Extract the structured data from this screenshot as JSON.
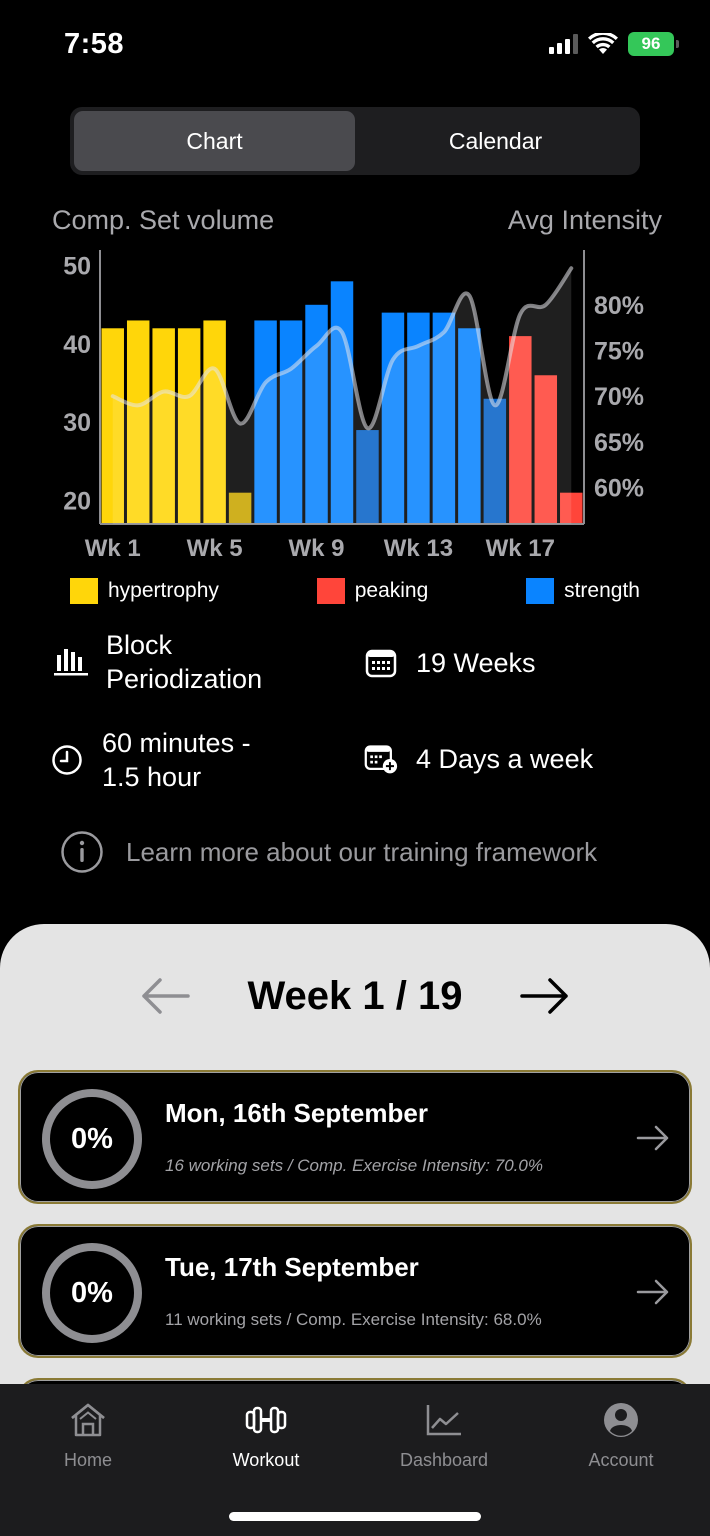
{
  "status": {
    "time": "7:58",
    "battery": "96"
  },
  "segments": [
    {
      "label": "Chart",
      "active": true
    },
    {
      "label": "Calendar",
      "active": false
    }
  ],
  "chart_data": {
    "type": "bar",
    "left_axis_label": "Comp. Set volume",
    "right_axis_label": "Avg Intensity",
    "left_ticks": [
      "50",
      "40",
      "30",
      "20"
    ],
    "right_ticks": [
      "80%",
      "75%",
      "70%",
      "65%",
      "60%"
    ],
    "ylim": [
      17,
      52
    ],
    "y2lim": [
      56,
      86
    ],
    "x_tick_labels": [
      "Wk 1",
      "Wk 5",
      "Wk 9",
      "Wk 13",
      "Wk 17"
    ],
    "categories": [
      "1",
      "2",
      "3",
      "4",
      "5",
      "6",
      "7",
      "8",
      "9",
      "10",
      "11",
      "12",
      "13",
      "14",
      "15",
      "16",
      "17",
      "18",
      "19"
    ],
    "volume": [
      42,
      43,
      42,
      42,
      43,
      21,
      43,
      43,
      45,
      48,
      29,
      44,
      44,
      44,
      42,
      33,
      41,
      36,
      21
    ],
    "phase": [
      "hypertrophy",
      "hypertrophy",
      "hypertrophy",
      "hypertrophy",
      "hypertrophy",
      "hypertrophy",
      "strength",
      "strength",
      "strength",
      "strength",
      "strength",
      "strength",
      "strength",
      "strength",
      "strength",
      "strength",
      "peaking",
      "peaking",
      "peaking"
    ],
    "deload": [
      false,
      false,
      false,
      false,
      false,
      true,
      false,
      false,
      false,
      false,
      true,
      false,
      false,
      false,
      false,
      true,
      false,
      false,
      false
    ],
    "intensity": [
      70.0,
      69.0,
      70.5,
      70.0,
      73.0,
      67.0,
      71.5,
      73.0,
      75.5,
      77.0,
      66.5,
      74.0,
      75.5,
      77.0,
      81.0,
      69.0,
      79.0,
      80.0,
      84.0
    ],
    "legend": [
      {
        "label": "hypertrophy",
        "color": "#FFD60A"
      },
      {
        "label": "peaking",
        "color": "#FF453A"
      },
      {
        "label": "strength",
        "color": "#0A84FF"
      }
    ],
    "deload_colors": {
      "hypertrophy": "#C9A500",
      "strength": "#0A64C8",
      "peaking": "#C8302A"
    }
  },
  "info": {
    "method": "Block\nPeriodization",
    "weeks": "19 Weeks",
    "duration": "60 minutes -\n1.5 hour",
    "frequency": "4 Days a week",
    "learn_more": "Learn more about our training framework"
  },
  "week_nav": {
    "title": "Week 1 / 19"
  },
  "days": [
    {
      "progress": "0%",
      "title": "Mon, 16th September",
      "subtitle": "16 working sets / Comp. Exercise Intensity: 70.0%"
    },
    {
      "progress": "0%",
      "title": "Tue, 17th September",
      "subtitle": "11 working sets / Comp. Exercise Intensity: 68.0%"
    }
  ],
  "tabs": [
    {
      "label": "Home",
      "icon": "home-icon",
      "active": false
    },
    {
      "label": "Workout",
      "icon": "dumbbell-icon",
      "active": true
    },
    {
      "label": "Dashboard",
      "icon": "line-chart-icon",
      "active": false
    },
    {
      "label": "Account",
      "icon": "person-circle-icon",
      "active": false
    }
  ]
}
